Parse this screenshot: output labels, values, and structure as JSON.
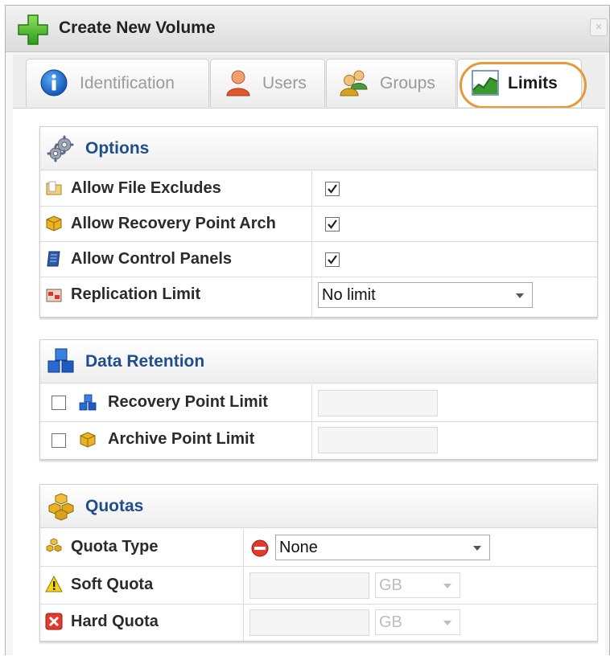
{
  "window": {
    "title": "Create New Volume",
    "close_label": "×"
  },
  "tabs": [
    {
      "label": "Identification",
      "icon": "info-icon",
      "active": false
    },
    {
      "label": "Users",
      "icon": "user-icon",
      "active": false
    },
    {
      "label": "Groups",
      "icon": "group-icon",
      "active": false
    },
    {
      "label": "Limits",
      "icon": "chart-icon",
      "active": true
    }
  ],
  "options": {
    "title": "Options",
    "icon": "gears-icon",
    "rows": [
      {
        "label": "Allow File Excludes",
        "icon": "folder-icon",
        "checked": true
      },
      {
        "label": "Allow Recovery Point Arch",
        "icon": "archive-box-icon",
        "checked": true
      },
      {
        "label": "Allow Control Panels",
        "icon": "control-panel-icon",
        "checked": true
      },
      {
        "label": "Replication Limit",
        "icon": "replication-icon",
        "value": "No limit"
      }
    ]
  },
  "data_retention": {
    "title": "Data Retention",
    "icon": "blue-cubes-icon",
    "rows": [
      {
        "label": "Recovery Point Limit",
        "icon": "blue-cubes-small-icon",
        "checked": false,
        "value": ""
      },
      {
        "label": "Archive Point Limit",
        "icon": "gold-box-icon",
        "checked": false,
        "value": ""
      }
    ]
  },
  "quotas": {
    "title": "Quotas",
    "icon": "gold-stack-icon",
    "rows": [
      {
        "label": "Quota Type",
        "icon": "gold-stack-small-icon",
        "status_icon": "no-entry-icon",
        "value": "None"
      },
      {
        "label": "Soft Quota",
        "icon": "warning-icon",
        "value": "",
        "unit": "GB"
      },
      {
        "label": "Hard Quota",
        "icon": "error-x-icon",
        "value": "",
        "unit": "GB"
      }
    ]
  },
  "colors": {
    "accent_ring": "#e8973a",
    "section_title": "#1f4e8c"
  }
}
